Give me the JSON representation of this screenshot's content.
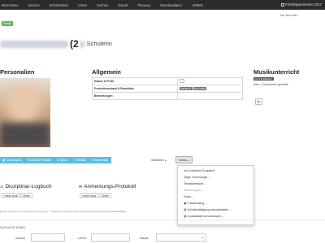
{
  "topnav": {
    "items": [
      "Mein Menu",
      "Service",
      "Schulbetrieb",
      "Listen",
      "Suchen",
      "Export",
      "Planung",
      "Stundenplaner",
      "ADMIN"
    ],
    "semester": "Frühlingssemester 2017"
  },
  "header": {
    "signed_in": "Sie sind hier:",
    "back_label": "Zurück",
    "student_paren": "(2",
    "student_role": "Schülerin"
  },
  "sections": {
    "personalien": "Personalien",
    "allgemein": "Allgemein",
    "musikunterricht": "Musikunterricht"
  },
  "general_info": {
    "rows": [
      {
        "key": "Klasse & Profil"
      },
      {
        "key": "Promotionsstand & Repetition",
        "tags": [
          "DEFINITIV",
          "NICHT REP"
        ]
      },
      {
        "key": "Bemerkungen"
      }
    ]
  },
  "music": {
    "badge": "Keine Musiklektion",
    "text": "Kein 1. Instrument gewählt"
  },
  "toolbar": {
    "buttons": [
      "Stundenplan",
      "Aktuelle Testate",
      "Noten",
      "Details",
      "Bearbeiten"
    ],
    "szenarien": "Szenarien",
    "extras": "Extras"
  },
  "dropdown": {
    "items": [
      {
        "label": "Ist in welchen Gruppen?",
        "disabled": false
      },
      {
        "label": "Zeige Chronologie ...",
        "disabled": false
      },
      {
        "label": "Testatübersicht ...",
        "disabled": false
      },
      {
        "label": "Maturzeugnis ...",
        "disabled": true
      },
      {
        "label": "Fotos ...",
        "disabled": false
      },
      {
        "label": "Fotoshooting ...",
        "disabled": false,
        "icon": "camera-icon"
      },
      {
        "label": "Schulbestätigung herunterladen ...",
        "disabled": false,
        "icon": "file-icon"
      },
      {
        "label": "Kontaktblatt herunterladen ...",
        "disabled": false,
        "icon": "file-icon"
      }
    ]
  },
  "logbook": {
    "title": "Disziplinar-Logbuch",
    "new": "Neue Notiz",
    "open": "Öffnen"
  },
  "protocol": {
    "title": "Anmerkungs-Protokoll",
    "new": "Neue Notiz",
    "open": "Öffnen"
  },
  "footer": {
    "meta": "Erstellt: Unbekannt am: 08.04.2016 | Letzte Lig ... | Bearbeitet am: 08.04.2016 | ID: 91a4ca30-ae64-45f4-92b4-f6410ba8985e"
  },
  "panel": {
    "title": "SCHÜLER PANEL",
    "labels": [
      "Schüler",
      "Lehrer",
      "Klasse"
    ]
  }
}
